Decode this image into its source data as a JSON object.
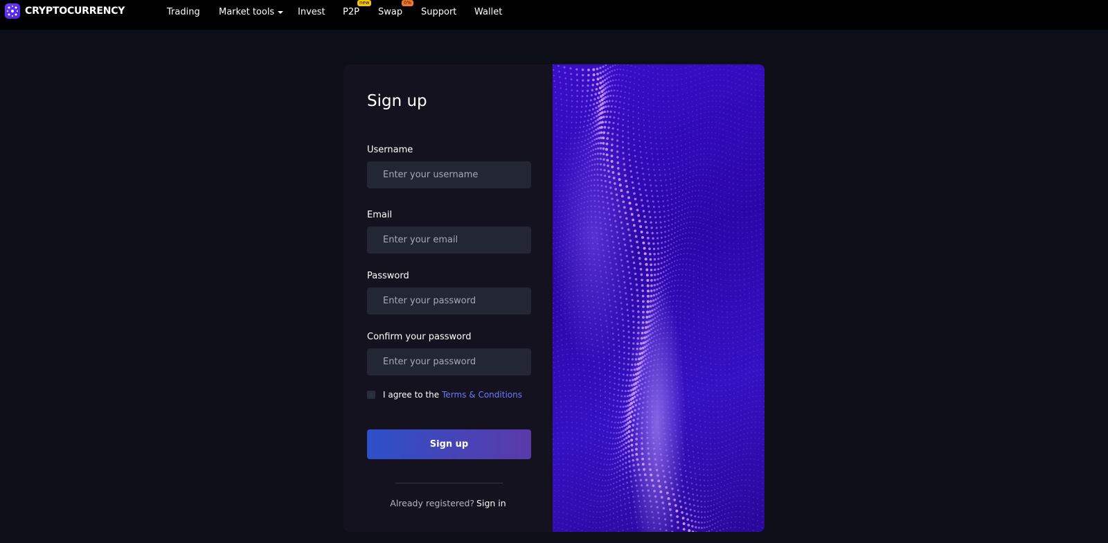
{
  "brand": {
    "name": "CRYPTOCURRENCY",
    "logo_icon": "brand-logo-icon",
    "accent": "#5b2ff0"
  },
  "nav": {
    "items": [
      {
        "label": "Trading"
      },
      {
        "label": "Market tools"
      },
      {
        "label": "Invest"
      },
      {
        "label": "P2P",
        "badge": "new"
      },
      {
        "label": "Swap",
        "badge": "0%"
      },
      {
        "label": "Support"
      },
      {
        "label": "Wallet"
      }
    ]
  },
  "form": {
    "title": "Sign up",
    "username": {
      "label": "Username",
      "placeholder": "Enter your username"
    },
    "email": {
      "label": "Email",
      "placeholder": "Enter your email"
    },
    "password": {
      "label": "Password",
      "placeholder": "Enter your password"
    },
    "confirm": {
      "label": "Confirm your password",
      "placeholder": "Enter your password"
    },
    "agree_text": "I agree to the",
    "terms_link": "Terms & Conditions",
    "submit_label": "Sign up",
    "already_text": "Already registered?",
    "signin_link": "Sign in"
  },
  "colors": {
    "background": "#0c0f17",
    "navbar": "#010102",
    "panel": "#15121f",
    "input": "#232733",
    "link": "#6a7bff",
    "button_gradient_start": "#2d50c8",
    "button_gradient_end": "#5a3aa8",
    "badge_new": "#f1c40f",
    "badge_pct": "#f07a2a"
  }
}
